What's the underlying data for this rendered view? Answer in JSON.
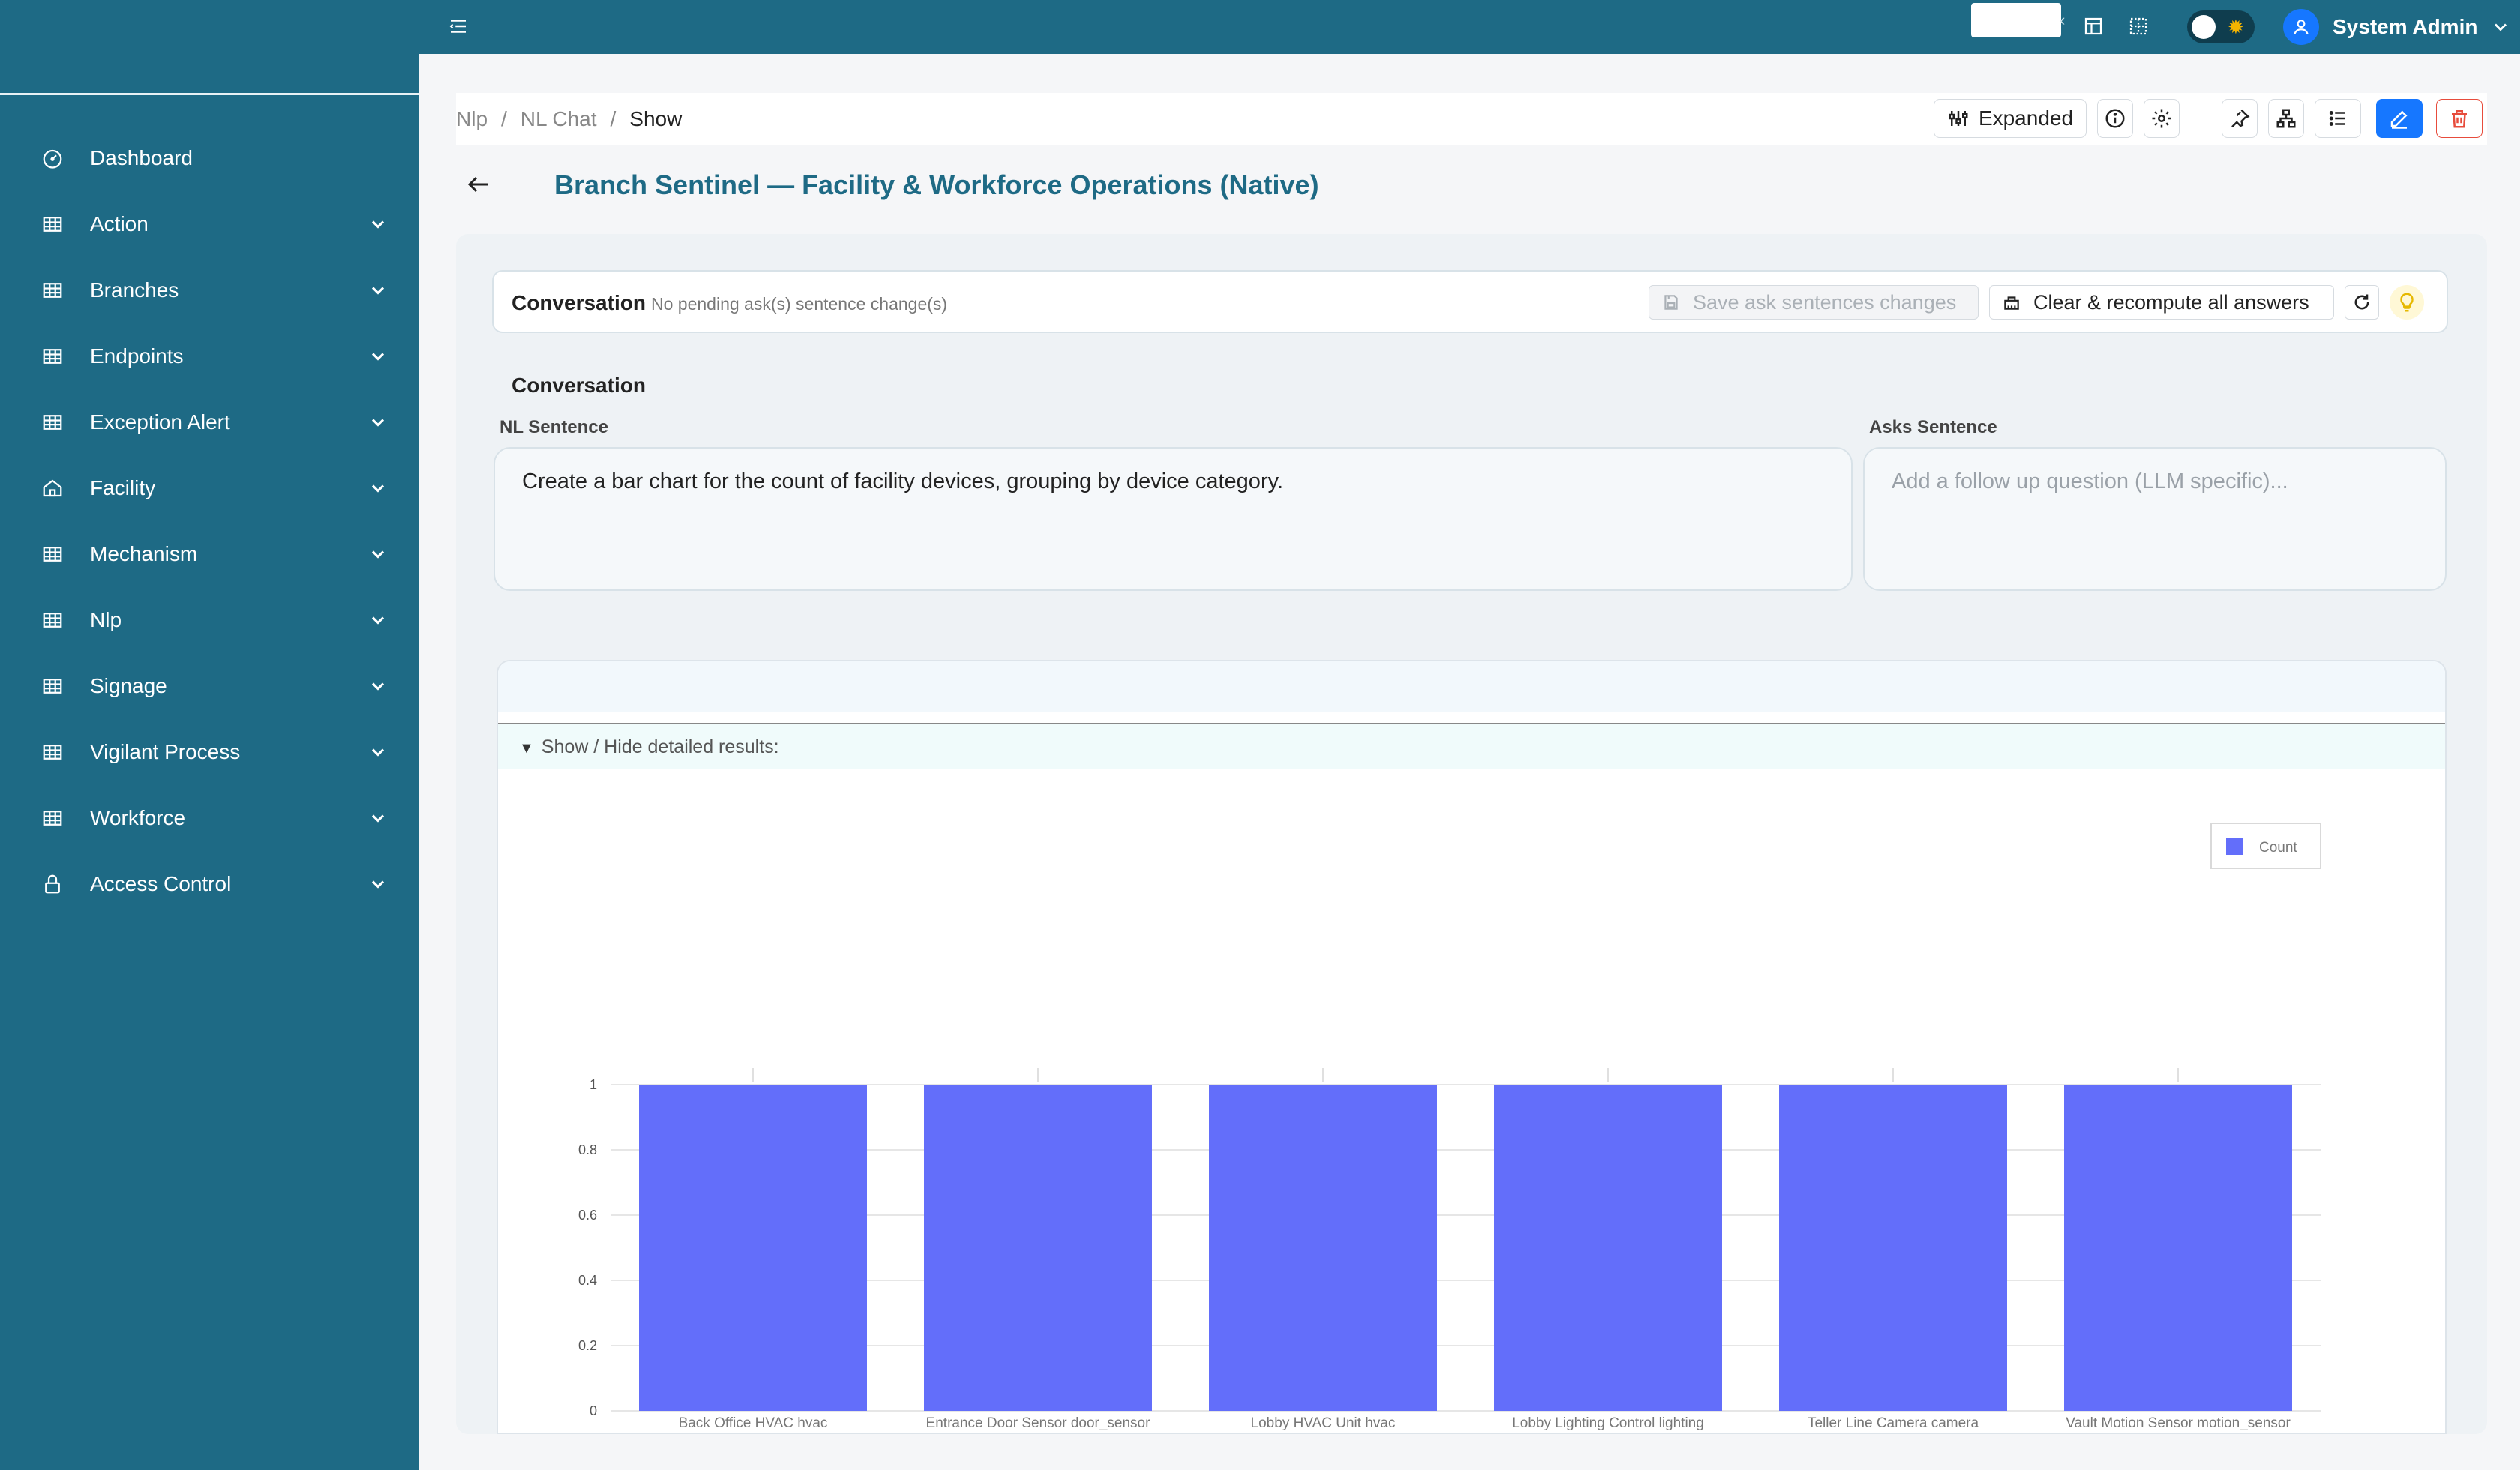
{
  "sidebar": {
    "items": [
      {
        "label": "Dashboard",
        "icon": "dashboard-icon",
        "has_children": false
      },
      {
        "label": "Action",
        "icon": "table-icon",
        "has_children": true
      },
      {
        "label": "Branches",
        "icon": "table-icon",
        "has_children": true
      },
      {
        "label": "Endpoints",
        "icon": "table-icon",
        "has_children": true
      },
      {
        "label": "Exception Alert",
        "icon": "table-icon",
        "has_children": true
      },
      {
        "label": "Facility",
        "icon": "home-icon",
        "has_children": true
      },
      {
        "label": "Mechanism",
        "icon": "table-icon",
        "has_children": true
      },
      {
        "label": "Nlp",
        "icon": "table-icon",
        "has_children": true
      },
      {
        "label": "Signage",
        "icon": "table-icon",
        "has_children": true
      },
      {
        "label": "Vigilant Process",
        "icon": "table-icon",
        "has_children": true
      },
      {
        "label": "Workforce",
        "icon": "table-icon",
        "has_children": true
      },
      {
        "label": "Access Control",
        "icon": "lock-icon",
        "has_children": true
      }
    ]
  },
  "topbar": {
    "user_name": "System Admin",
    "theme_toggle": "light"
  },
  "breadcrumb": {
    "items": [
      "Nlp",
      "NL Chat",
      "Show"
    ]
  },
  "toolbar": {
    "expanded_label": "Expanded"
  },
  "page": {
    "title": "Branch Sentinel — Facility & Workforce Operations (Native)"
  },
  "conversation": {
    "bar_label": "Conversation",
    "pending_text": "No pending ask(s) sentence change(s)",
    "save_label": "Save ask sentences changes",
    "clear_label": "Clear & recompute all answers",
    "section_title": "Conversation",
    "nl_label": "NL Sentence",
    "nl_value": "Create a bar chart for the count of facility devices, grouping by device category.",
    "asks_label": "Asks Sentence",
    "asks_placeholder": "Add a follow up question (LLM specific)..."
  },
  "results": {
    "toggle_label": "Show / Hide detailed results:"
  },
  "chart_data": {
    "type": "bar",
    "categories": [
      "Back Office HVAC hvac",
      "Entrance Door Sensor door_sensor",
      "Lobby HVAC Unit hvac",
      "Lobby Lighting Control lighting",
      "Teller Line Camera camera",
      "Vault Motion Sensor motion_sensor"
    ],
    "series": [
      {
        "name": "Count",
        "values": [
          1,
          1,
          1,
          1,
          1,
          1
        ],
        "color": "#636efa"
      }
    ],
    "yticks": [
      "0",
      "0.2",
      "0.4",
      "0.6",
      "0.8",
      "1"
    ],
    "ylim": [
      0,
      1
    ],
    "grid": true,
    "legend": "top-right"
  },
  "colors": {
    "brand": "#1e6a85",
    "primary": "#1677ff",
    "danger": "#e74c3c",
    "bar": "#636efa"
  }
}
